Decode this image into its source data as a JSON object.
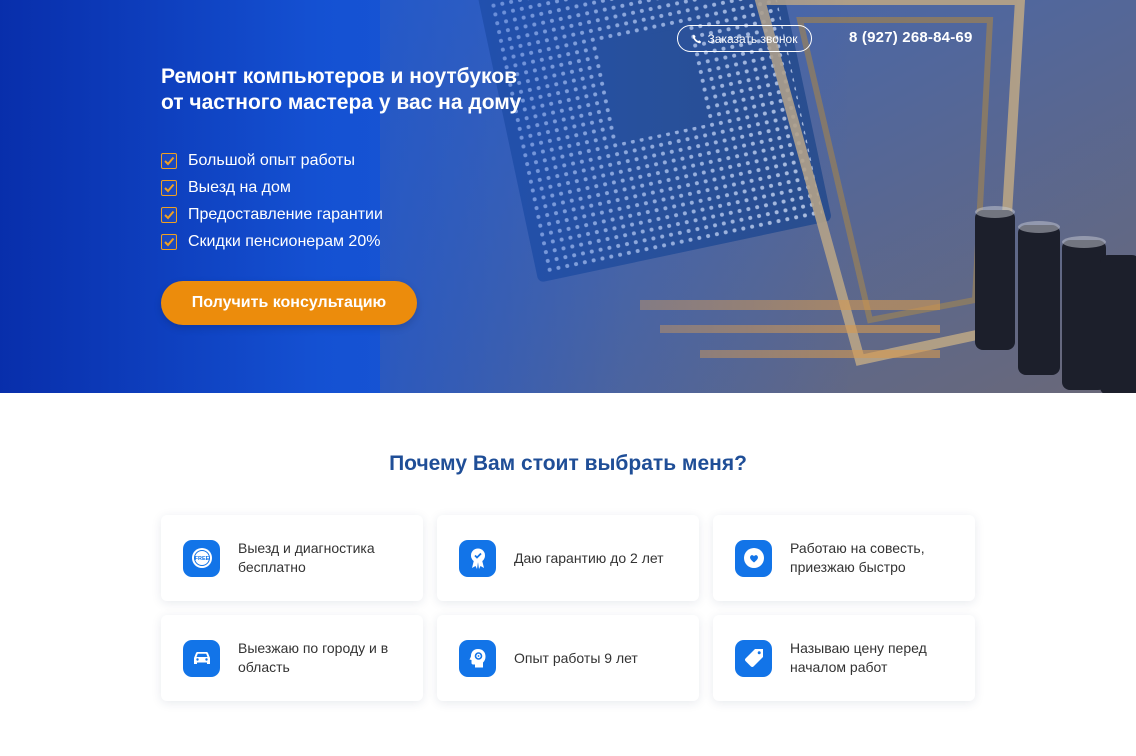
{
  "header": {
    "callback_label": "Заказать звонок",
    "phone": "8 (927) 268-84-69"
  },
  "hero": {
    "title_line1": "Ремонт компьютеров и ноутбуков",
    "title_line2": "от частного мастера у вас на дому",
    "features": [
      "Большой опыт работы",
      "Выезд на дом",
      "Предоставление гарантии",
      "Скидки пенсионерам 20%"
    ],
    "cta_label": "Получить консультацию"
  },
  "why": {
    "title": "Почему Вам стоит выбрать меня?",
    "cards": [
      {
        "icon": "free-badge-icon",
        "text": "Выезд и диагностика бесплатно"
      },
      {
        "icon": "award-ribbon-icon",
        "text": "Даю гарантию до 2 лет"
      },
      {
        "icon": "heart-hand-icon",
        "text": "Работаю на совесть, приезжаю быстро"
      },
      {
        "icon": "car-icon",
        "text": "Выезжаю по городу и в область"
      },
      {
        "icon": "head-gear-icon",
        "text": "Опыт работы 9 лет"
      },
      {
        "icon": "price-tag-icon",
        "text": "Называю цену перед началом работ"
      }
    ]
  },
  "colors": {
    "accent_orange": "#ec8c0c",
    "icon_blue": "#1274e8",
    "title_blue": "#1f4e97",
    "hero_blue": "#1655d6"
  }
}
